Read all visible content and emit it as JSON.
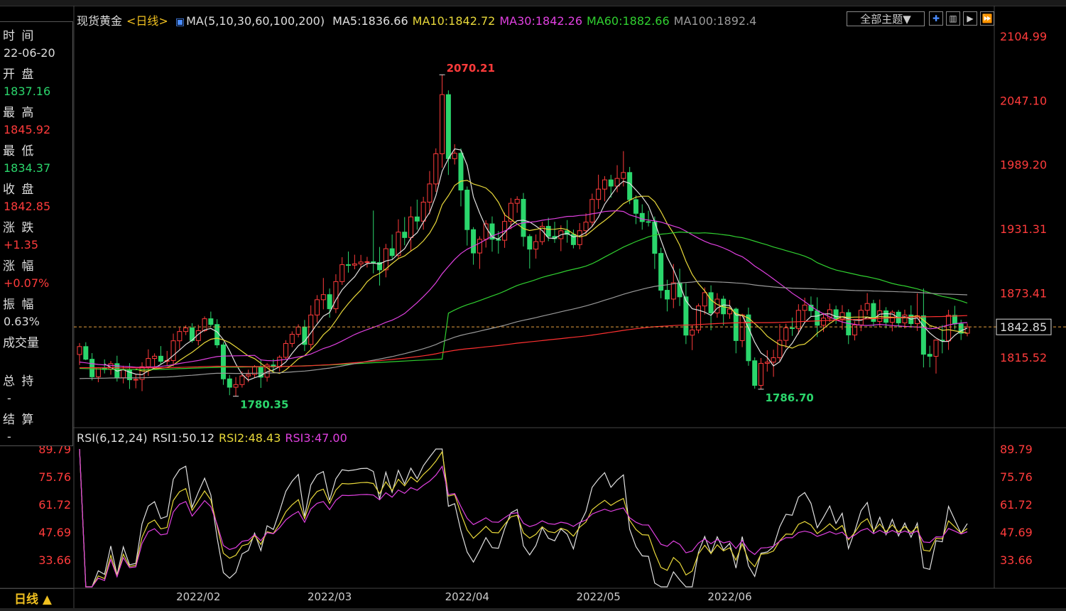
{
  "title": {
    "name": "现货黄金",
    "period": "<日线>"
  },
  "ma_legend": {
    "label": "MA(5,10,30,60,100,200)",
    "items": [
      {
        "text": "MA5:1836.66",
        "color": "#e0e0e0"
      },
      {
        "text": "MA10:1842.72",
        "color": "#e8d83a"
      },
      {
        "text": "MA30:1842.26",
        "color": "#e040e0"
      },
      {
        "text": "MA60:1882.66",
        "color": "#30d030"
      },
      {
        "text": "MA100:1892.4",
        "color": "#9a9a9a"
      }
    ]
  },
  "rsi_legend": {
    "label": "RSI(6,12,24)",
    "items": [
      {
        "text": "RSI1:50.12",
        "color": "#e0e0e0"
      },
      {
        "text": "RSI2:48.43",
        "color": "#e8d83a"
      },
      {
        "text": "RSI3:47.00",
        "color": "#e040e0"
      }
    ]
  },
  "toolbar": {
    "theme_label": "全部主题▼",
    "icons": [
      "crosshair-icon",
      "bar-chart-icon",
      "play-icon",
      "forward-icon"
    ]
  },
  "info": {
    "time_label": "时 间",
    "time_value": "22-06-20",
    "open_label": "开 盘",
    "open_value": "1837.16",
    "high_label": "最 高",
    "high_value": "1845.92",
    "low_label": "最 低",
    "low_value": "1834.37",
    "close_label": "收 盘",
    "close_value": "1842.85",
    "change_label": "涨 跌",
    "change_value": "+1.35",
    "pct_label": "涨 幅",
    "pct_value": "+0.07%",
    "amp_label": "振 幅",
    "amp_value": "0.63%",
    "vol_label": "成交量",
    "oi_label": "总 持",
    "oi_value": "-",
    "settle_label": "结 算",
    "settle_value": "-"
  },
  "period_tab": {
    "label": "日线 ▲"
  },
  "colors": {
    "up": "#ff3b3b",
    "down": "#2bd66c",
    "grid_text": "#ff3b3b",
    "rsi_axis": "#ff3b3b"
  },
  "chart_data": [
    {
      "type": "candlestick",
      "title": "现货黄金 日线",
      "y_ticks": [
        2104.99,
        2047.1,
        1989.2,
        1931.31,
        1873.41,
        1815.52
      ],
      "ylim": [
        1752,
        2112
      ],
      "x_ticks": [
        "2022/02",
        "2022/03",
        "2022/04",
        "2022/05",
        "2022/06"
      ],
      "last_price": 1842.85,
      "annotations": [
        {
          "text": "2070.21",
          "value": 2070.21
        },
        {
          "text": "1780.35",
          "value": 1780.35
        },
        {
          "text": "1786.70",
          "value": 1786.7
        }
      ],
      "ohlc": [
        [
          1818.0,
          1828.29,
          1808.5,
          1825.14
        ],
        [
          1825.14,
          1829.06,
          1812.87,
          1813.72
        ],
        [
          1813.72,
          1819.25,
          1794.64,
          1797.89
        ],
        [
          1797.89,
          1806.55,
          1792.99,
          1806.16
        ],
        [
          1806.16,
          1813.57,
          1800.94,
          1804.49
        ],
        [
          1804.49,
          1812.13,
          1799.75,
          1809.77
        ],
        [
          1809.77,
          1816.89,
          1793.6,
          1797.06
        ],
        [
          1797.06,
          1807.88,
          1791.94,
          1804.05
        ],
        [
          1804.05,
          1810.21,
          1786.92,
          1795.21
        ],
        [
          1795.21,
          1799.92,
          1787.52,
          1795.55
        ],
        [
          1795.55,
          1810.99,
          1784.96,
          1806.97
        ],
        [
          1806.97,
          1822.63,
          1798.73,
          1814.42
        ],
        [
          1814.42,
          1819.01,
          1806.71,
          1816.47
        ],
        [
          1816.47,
          1825.59,
          1809.44,
          1811.86
        ],
        [
          1811.86,
          1821.23,
          1808.26,
          1812.57
        ],
        [
          1812.57,
          1836.86,
          1807.41,
          1830.36
        ],
        [
          1830.36,
          1842.5,
          1822.81,
          1838.69
        ],
        [
          1838.69,
          1844.22,
          1835.51,
          1841.97
        ],
        [
          1841.97,
          1846.17,
          1828.7,
          1830.6
        ],
        [
          1830.6,
          1844.84,
          1826.2,
          1839.49
        ],
        [
          1839.49,
          1852.35,
          1838.26,
          1850.23
        ],
        [
          1850.23,
          1856.68,
          1843.05,
          1845.03
        ],
        [
          1845.03,
          1849.82,
          1823.84,
          1826.64
        ],
        [
          1826.64,
          1829.14,
          1790.61,
          1796.02
        ],
        [
          1796.02,
          1799.57,
          1781.3,
          1788.49
        ],
        [
          1788.49,
          1797.62,
          1780.35,
          1790.88
        ],
        [
          1790.88,
          1802.76,
          1788.16,
          1798.65
        ],
        [
          1798.65,
          1804.31,
          1793.04,
          1800.07
        ],
        [
          1800.07,
          1808.43,
          1796.94,
          1807.18
        ],
        [
          1807.18,
          1813.73,
          1787.87,
          1797.57
        ],
        [
          1797.57,
          1810.38,
          1793.53,
          1808.53
        ],
        [
          1808.53,
          1814.0,
          1801.63,
          1806.81
        ],
        [
          1806.81,
          1817.33,
          1802.66,
          1815.49
        ],
        [
          1815.49,
          1830.94,
          1813.74,
          1827.95
        ],
        [
          1827.95,
          1838.86,
          1824.56,
          1836.24
        ],
        [
          1836.24,
          1845.19,
          1833.54,
          1842.79
        ],
        [
          1842.79,
          1849.15,
          1821.08,
          1827.08
        ],
        [
          1827.08,
          1862.29,
          1822.86,
          1853.62
        ],
        [
          1853.62,
          1871.55,
          1846.72,
          1867.4
        ],
        [
          1867.4,
          1887.0,
          1858.72,
          1871.99
        ],
        [
          1871.99,
          1877.51,
          1851.24,
          1859.23
        ],
        [
          1859.23,
          1890.35,
          1855.34,
          1883.73
        ],
        [
          1883.73,
          1905.71,
          1880.77,
          1898.98
        ],
        [
          1898.98,
          1910.82,
          1891.81,
          1898.54
        ],
        [
          1898.54,
          1907.96,
          1894.83,
          1899.71
        ],
        [
          1899.71,
          1907.81,
          1895.89,
          1901.36
        ],
        [
          1901.36,
          1906.07,
          1896.43,
          1901.67
        ],
        [
          1901.67,
          1947.77,
          1891.12,
          1900.93
        ],
        [
          1900.93,
          1914.97,
          1880.15,
          1894.33
        ],
        [
          1894.33,
          1917.74,
          1887.57,
          1913.38
        ],
        [
          1913.38,
          1926.2,
          1904.14,
          1907.16
        ],
        [
          1907.16,
          1939.87,
          1904.98,
          1928.34
        ],
        [
          1928.34,
          1941.92,
          1916.43,
          1923.44
        ],
        [
          1923.44,
          1951.46,
          1910.93,
          1942.08
        ],
        [
          1942.08,
          1957.62,
          1930.51,
          1938.25
        ],
        [
          1938.25,
          1960.19,
          1930.54,
          1955.39
        ],
        [
          1955.39,
          1983.46,
          1944.32,
          1971.78
        ],
        [
          1971.78,
          2003.85,
          1964.65,
          1998.98
        ],
        [
          1998.98,
          2070.21,
          1986.26,
          2052.31
        ],
        [
          2052.31,
          2056.15,
          1979.87,
          1994.6
        ],
        [
          1994.6,
          2007.57,
          1989.32,
          1999.45
        ],
        [
          1999.45,
          2003.8,
          1951.56,
          1966.27
        ],
        [
          1966.27,
          1969.48,
          1916.23,
          1930.58
        ],
        [
          1930.58,
          1932.85,
          1898.96,
          1909.53
        ],
        [
          1909.53,
          1924.55,
          1895.19,
          1921.89
        ],
        [
          1921.89,
          1939.04,
          1914.44,
          1935.81
        ],
        [
          1935.81,
          1942.48,
          1910.71,
          1921.91
        ],
        [
          1921.91,
          1929.27,
          1908.9,
          1921.03
        ],
        [
          1921.03,
          1945.9,
          1914.15,
          1937.98
        ],
        [
          1937.98,
          1959.06,
          1930.93,
          1954.33
        ],
        [
          1954.33,
          1960.68,
          1945.81,
          1957.93
        ],
        [
          1957.93,
          1963.62,
          1915.44,
          1924.4
        ],
        [
          1924.4,
          1926.48,
          1895.53,
          1913.0
        ],
        [
          1913.0,
          1926.21,
          1904.44,
          1919.78
        ],
        [
          1919.78,
          1937.59,
          1916.81,
          1933.58
        ],
        [
          1933.58,
          1941.33,
          1920.17,
          1924.51
        ],
        [
          1924.51,
          1937.68,
          1918.62,
          1922.42
        ],
        [
          1922.42,
          1934.5,
          1911.17,
          1929.53
        ],
        [
          1929.53,
          1939.21,
          1918.8,
          1926.3
        ],
        [
          1926.3,
          1930.63,
          1913.7,
          1917.05
        ],
        [
          1917.05,
          1936.49,
          1912.92,
          1929.62
        ],
        [
          1929.62,
          1945.33,
          1924.72,
          1937.36
        ],
        [
          1937.36,
          1963.07,
          1933.03,
          1957.81
        ],
        [
          1957.81,
          1980.11,
          1949.25,
          1967.13
        ],
        [
          1967.13,
          1978.84,
          1956.14,
          1975.45
        ],
        [
          1975.45,
          1979.97,
          1959.44,
          1969.81
        ],
        [
          1969.81,
          1988.7,
          1964.29,
          1976.75
        ],
        [
          1976.75,
          2001.37,
          1969.55,
          1982.09
        ],
        [
          1982.09,
          1987.12,
          1953.55,
          1957.64
        ],
        [
          1957.64,
          1961.53,
          1935.54,
          1945.25
        ],
        [
          1945.25,
          1953.42,
          1930.51,
          1937.81
        ],
        [
          1937.81,
          1947.64,
          1933.44,
          1937.38
        ],
        [
          1937.38,
          1942.38,
          1895.11,
          1909.17
        ],
        [
          1909.17,
          1914.31,
          1868.69,
          1875.92
        ],
        [
          1875.92,
          1885.41,
          1856.84,
          1867.97
        ],
        [
          1867.97,
          1899.59,
          1859.77,
          1882.68
        ],
        [
          1882.68,
          1895.33,
          1861.71,
          1869.98
        ],
        [
          1869.98,
          1882.21,
          1827.41,
          1835.46
        ],
        [
          1835.46,
          1844.27,
          1821.95,
          1840.08
        ],
        [
          1840.08,
          1863.95,
          1837.1,
          1861.77
        ],
        [
          1861.77,
          1878.41,
          1854.06,
          1873.77
        ],
        [
          1873.77,
          1880.32,
          1839.81,
          1855.43
        ],
        [
          1855.43,
          1873.32,
          1851.15,
          1867.93
        ],
        [
          1867.93,
          1870.94,
          1844.24,
          1854.64
        ],
        [
          1854.64,
          1867.13,
          1850.18,
          1858.95
        ],
        [
          1858.95,
          1860.33,
          1819.09,
          1830.54
        ],
        [
          1830.54,
          1854.76,
          1824.64,
          1853.72
        ],
        [
          1853.72,
          1860.32,
          1807.84,
          1812.37
        ],
        [
          1812.37,
          1815.38,
          1787.24,
          1790.17
        ],
        [
          1790.17,
          1814.82,
          1786.7,
          1810.02
        ],
        [
          1810.02,
          1821.82,
          1802.56,
          1811.1
        ],
        [
          1811.1,
          1822.32,
          1797.87,
          1815.09
        ],
        [
          1815.09,
          1845.47,
          1811.86,
          1830.74
        ],
        [
          1830.74,
          1845.76,
          1823.91,
          1842.04
        ],
        [
          1842.04,
          1851.31,
          1834.82,
          1841.42
        ],
        [
          1841.42,
          1863.33,
          1836.08,
          1857.81
        ],
        [
          1857.81,
          1869.22,
          1848.72,
          1862.57
        ],
        [
          1862.57,
          1870.32,
          1851.98,
          1857.47
        ],
        [
          1857.47,
          1869.58,
          1833.74,
          1844.37
        ],
        [
          1844.37,
          1855.57,
          1838.32,
          1850.79
        ],
        [
          1850.79,
          1863.86,
          1847.32,
          1858.35
        ],
        [
          1858.35,
          1862.08,
          1845.54,
          1850.07
        ],
        [
          1850.07,
          1862.51,
          1840.37,
          1855.79
        ],
        [
          1855.79,
          1858.84,
          1827.38,
          1835.6
        ],
        [
          1835.6,
          1848.09,
          1830.71,
          1844.67
        ],
        [
          1844.67,
          1862.64,
          1839.04,
          1857.86
        ],
        [
          1857.86,
          1873.35,
          1853.65,
          1863.96
        ],
        [
          1863.96,
          1867.34,
          1843.22,
          1847.8
        ],
        [
          1847.8,
          1867.57,
          1842.67,
          1857.38
        ],
        [
          1857.38,
          1860.68,
          1841.48,
          1847.03
        ],
        [
          1847.03,
          1857.95,
          1838.87,
          1856.17
        ],
        [
          1856.17,
          1858.21,
          1842.34,
          1846.51
        ],
        [
          1846.51,
          1858.43,
          1841.49,
          1853.63
        ],
        [
          1853.63,
          1862.31,
          1842.16,
          1845.82
        ],
        [
          1845.82,
          1873.07,
          1839.22,
          1852.92
        ],
        [
          1852.92,
          1877.51,
          1806.36,
          1818.21
        ],
        [
          1818.21,
          1825.92,
          1806.46,
          1816.38
        ],
        [
          1816.38,
          1831.56,
          1800.81,
          1830.95
        ],
        [
          1830.95,
          1844.6,
          1819.06,
          1830.28
        ],
        [
          1830.28,
          1858.34,
          1822.15,
          1853.35
        ],
        [
          1853.35,
          1861.89,
          1840.54,
          1845.55
        ],
        [
          1845.55,
          1849.3,
          1831.07,
          1837.16
        ],
        [
          1837.16,
          1845.92,
          1834.37,
          1842.85
        ]
      ],
      "ma_colors": [
        "#e0e0e0",
        "#e8d83a",
        "#e040e0",
        "#30d030",
        "#9a9a9a",
        "#ff3030"
      ],
      "ma_periods": [
        5,
        10,
        30,
        60,
        100,
        200
      ],
      "ma_seeds": {
        "ma30": [
          1811.2,
          1810.5,
          1809.7,
          1809.0,
          1808.6,
          1808.2,
          1807.7,
          1807.3,
          1807.0,
          1806.6,
          1806.4,
          1806.6,
          1806.9,
          1807.3,
          1807.9,
          1808.8,
          1809.9,
          1810.8,
          1811.7,
          1812.6,
          1813.8,
          1815.0,
          1816.1,
          1816.6,
          1816.7,
          1816.8,
          1816.9,
          1817.0,
          1817.2,
          1817.4
        ],
        "ma60": [
          1805.5,
          1805.3,
          1805.1,
          1804.9,
          1804.8,
          1804.7,
          1804.6,
          1804.5,
          1804.4,
          1804.3,
          1804.3,
          1804.4,
          1804.5,
          1804.6,
          1804.8,
          1805.0,
          1805.2,
          1805.4,
          1805.6,
          1805.8,
          1806.0,
          1806.2,
          1806.4,
          1806.5,
          1806.6,
          1806.6,
          1806.7,
          1806.8,
          1806.8,
          1806.9,
          1807.0,
          1807.1,
          1807.2,
          1807.3,
          1807.4,
          1807.6,
          1807.8,
          1808.0,
          1808.2,
          1808.4,
          1808.6,
          1808.8,
          1809.1,
          1809.4,
          1809.7,
          1810.0,
          1810.3,
          1810.6,
          1810.9,
          1811.2,
          1811.5,
          1811.8,
          1812.1,
          1812.4,
          1812.7,
          1813.0,
          1813.3,
          1813.6,
          1813.9,
          1814.2
        ],
        "ma100_start": 1796.0,
        "ma200_start": 1806.0
      }
    },
    {
      "type": "line",
      "title": "RSI(6,12,24)",
      "y_ticks": [
        89.79,
        75.76,
        61.72,
        47.69,
        33.66
      ],
      "ylim": [
        20,
        89.79
      ]
    }
  ]
}
